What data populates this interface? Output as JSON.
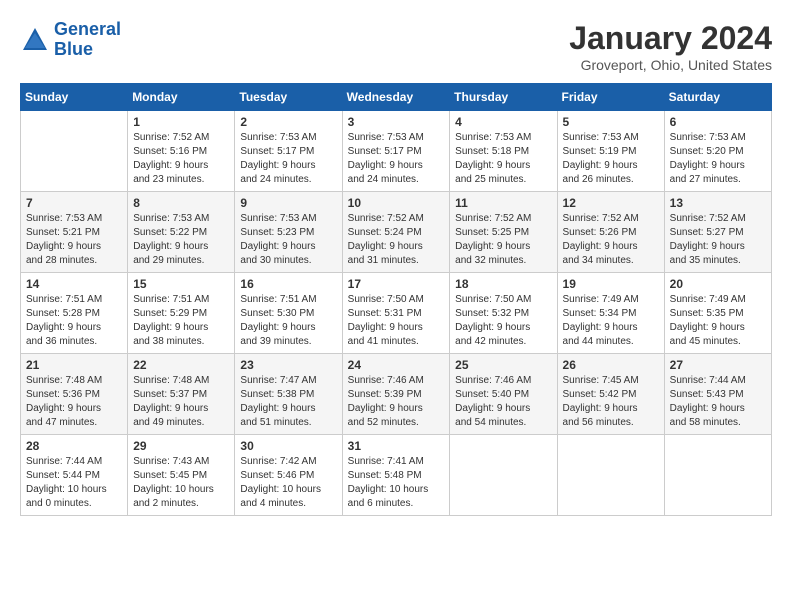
{
  "header": {
    "logo_line1": "General",
    "logo_line2": "Blue",
    "month": "January 2024",
    "location": "Groveport, Ohio, United States"
  },
  "weekdays": [
    "Sunday",
    "Monday",
    "Tuesday",
    "Wednesday",
    "Thursday",
    "Friday",
    "Saturday"
  ],
  "weeks": [
    [
      {
        "day": "",
        "info": ""
      },
      {
        "day": "1",
        "info": "Sunrise: 7:52 AM\nSunset: 5:16 PM\nDaylight: 9 hours\nand 23 minutes."
      },
      {
        "day": "2",
        "info": "Sunrise: 7:53 AM\nSunset: 5:17 PM\nDaylight: 9 hours\nand 24 minutes."
      },
      {
        "day": "3",
        "info": "Sunrise: 7:53 AM\nSunset: 5:17 PM\nDaylight: 9 hours\nand 24 minutes."
      },
      {
        "day": "4",
        "info": "Sunrise: 7:53 AM\nSunset: 5:18 PM\nDaylight: 9 hours\nand 25 minutes."
      },
      {
        "day": "5",
        "info": "Sunrise: 7:53 AM\nSunset: 5:19 PM\nDaylight: 9 hours\nand 26 minutes."
      },
      {
        "day": "6",
        "info": "Sunrise: 7:53 AM\nSunset: 5:20 PM\nDaylight: 9 hours\nand 27 minutes."
      }
    ],
    [
      {
        "day": "7",
        "info": "Sunrise: 7:53 AM\nSunset: 5:21 PM\nDaylight: 9 hours\nand 28 minutes."
      },
      {
        "day": "8",
        "info": "Sunrise: 7:53 AM\nSunset: 5:22 PM\nDaylight: 9 hours\nand 29 minutes."
      },
      {
        "day": "9",
        "info": "Sunrise: 7:53 AM\nSunset: 5:23 PM\nDaylight: 9 hours\nand 30 minutes."
      },
      {
        "day": "10",
        "info": "Sunrise: 7:52 AM\nSunset: 5:24 PM\nDaylight: 9 hours\nand 31 minutes."
      },
      {
        "day": "11",
        "info": "Sunrise: 7:52 AM\nSunset: 5:25 PM\nDaylight: 9 hours\nand 32 minutes."
      },
      {
        "day": "12",
        "info": "Sunrise: 7:52 AM\nSunset: 5:26 PM\nDaylight: 9 hours\nand 34 minutes."
      },
      {
        "day": "13",
        "info": "Sunrise: 7:52 AM\nSunset: 5:27 PM\nDaylight: 9 hours\nand 35 minutes."
      }
    ],
    [
      {
        "day": "14",
        "info": "Sunrise: 7:51 AM\nSunset: 5:28 PM\nDaylight: 9 hours\nand 36 minutes."
      },
      {
        "day": "15",
        "info": "Sunrise: 7:51 AM\nSunset: 5:29 PM\nDaylight: 9 hours\nand 38 minutes."
      },
      {
        "day": "16",
        "info": "Sunrise: 7:51 AM\nSunset: 5:30 PM\nDaylight: 9 hours\nand 39 minutes."
      },
      {
        "day": "17",
        "info": "Sunrise: 7:50 AM\nSunset: 5:31 PM\nDaylight: 9 hours\nand 41 minutes."
      },
      {
        "day": "18",
        "info": "Sunrise: 7:50 AM\nSunset: 5:32 PM\nDaylight: 9 hours\nand 42 minutes."
      },
      {
        "day": "19",
        "info": "Sunrise: 7:49 AM\nSunset: 5:34 PM\nDaylight: 9 hours\nand 44 minutes."
      },
      {
        "day": "20",
        "info": "Sunrise: 7:49 AM\nSunset: 5:35 PM\nDaylight: 9 hours\nand 45 minutes."
      }
    ],
    [
      {
        "day": "21",
        "info": "Sunrise: 7:48 AM\nSunset: 5:36 PM\nDaylight: 9 hours\nand 47 minutes."
      },
      {
        "day": "22",
        "info": "Sunrise: 7:48 AM\nSunset: 5:37 PM\nDaylight: 9 hours\nand 49 minutes."
      },
      {
        "day": "23",
        "info": "Sunrise: 7:47 AM\nSunset: 5:38 PM\nDaylight: 9 hours\nand 51 minutes."
      },
      {
        "day": "24",
        "info": "Sunrise: 7:46 AM\nSunset: 5:39 PM\nDaylight: 9 hours\nand 52 minutes."
      },
      {
        "day": "25",
        "info": "Sunrise: 7:46 AM\nSunset: 5:40 PM\nDaylight: 9 hours\nand 54 minutes."
      },
      {
        "day": "26",
        "info": "Sunrise: 7:45 AM\nSunset: 5:42 PM\nDaylight: 9 hours\nand 56 minutes."
      },
      {
        "day": "27",
        "info": "Sunrise: 7:44 AM\nSunset: 5:43 PM\nDaylight: 9 hours\nand 58 minutes."
      }
    ],
    [
      {
        "day": "28",
        "info": "Sunrise: 7:44 AM\nSunset: 5:44 PM\nDaylight: 10 hours\nand 0 minutes."
      },
      {
        "day": "29",
        "info": "Sunrise: 7:43 AM\nSunset: 5:45 PM\nDaylight: 10 hours\nand 2 minutes."
      },
      {
        "day": "30",
        "info": "Sunrise: 7:42 AM\nSunset: 5:46 PM\nDaylight: 10 hours\nand 4 minutes."
      },
      {
        "day": "31",
        "info": "Sunrise: 7:41 AM\nSunset: 5:48 PM\nDaylight: 10 hours\nand 6 minutes."
      },
      {
        "day": "",
        "info": ""
      },
      {
        "day": "",
        "info": ""
      },
      {
        "day": "",
        "info": ""
      }
    ]
  ]
}
